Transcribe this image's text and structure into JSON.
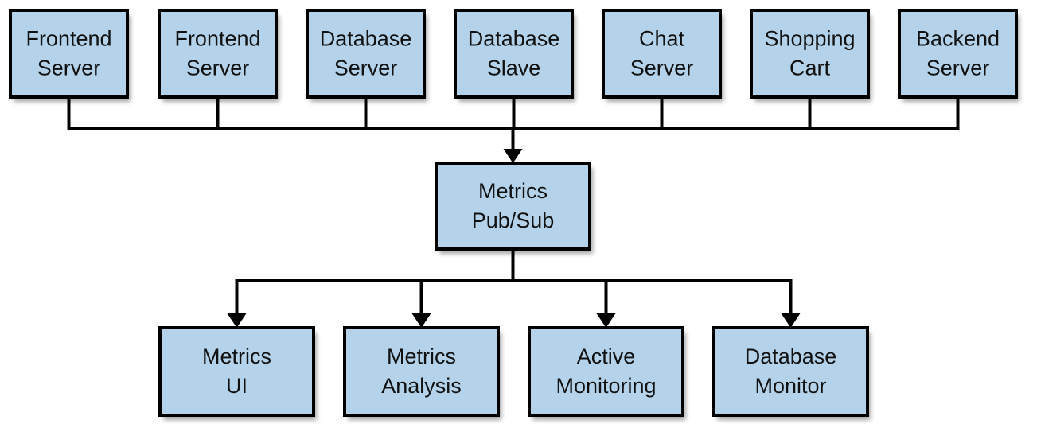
{
  "diagram": {
    "colors": {
      "node_fill": "#b4d3ea",
      "stroke": "#000000"
    },
    "sources": [
      {
        "id": "frontend-server-1",
        "lines": [
          "Frontend",
          "Server"
        ]
      },
      {
        "id": "frontend-server-2",
        "lines": [
          "Frontend",
          "Server"
        ]
      },
      {
        "id": "database-server",
        "lines": [
          "Database",
          "Server"
        ]
      },
      {
        "id": "database-slave",
        "lines": [
          "Database",
          "Slave"
        ]
      },
      {
        "id": "chat-server",
        "lines": [
          "Chat",
          "Server"
        ]
      },
      {
        "id": "shopping-cart",
        "lines": [
          "Shopping",
          "Cart"
        ]
      },
      {
        "id": "backend-server",
        "lines": [
          "Backend",
          "Server"
        ]
      }
    ],
    "hub": {
      "id": "metrics-pubsub",
      "lines": [
        "Metrics",
        "Pub/Sub"
      ]
    },
    "consumers": [
      {
        "id": "metrics-ui",
        "lines": [
          "Metrics",
          "UI"
        ]
      },
      {
        "id": "metrics-analysis",
        "lines": [
          "Metrics",
          "Analysis"
        ]
      },
      {
        "id": "active-monitoring",
        "lines": [
          "Active",
          "Monitoring"
        ]
      },
      {
        "id": "database-monitor",
        "lines": [
          "Database",
          "Monitor"
        ]
      }
    ],
    "edges": [
      {
        "from": "sources",
        "to": "metrics-pubsub"
      },
      {
        "from": "metrics-pubsub",
        "to": "metrics-ui"
      },
      {
        "from": "metrics-pubsub",
        "to": "metrics-analysis"
      },
      {
        "from": "metrics-pubsub",
        "to": "active-monitoring"
      },
      {
        "from": "metrics-pubsub",
        "to": "database-monitor"
      }
    ]
  }
}
